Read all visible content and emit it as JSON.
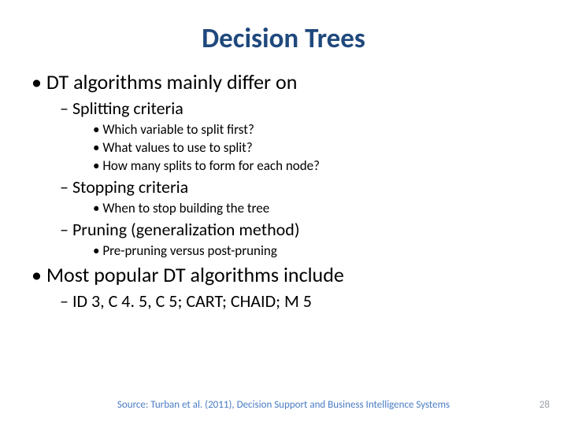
{
  "title": "Decision Trees",
  "bullets": [
    {
      "text": "DT algorithms mainly differ on",
      "children": [
        {
          "text": "Splitting criteria",
          "children": [
            {
              "text": "Which variable to split first?"
            },
            {
              "text": "What values to use to split?"
            },
            {
              "text": "How many splits to form for each node?"
            }
          ]
        },
        {
          "text": "Stopping criteria",
          "children": [
            {
              "text": "When to stop building the tree"
            }
          ]
        },
        {
          "text": "Pruning (generalization method)",
          "children": [
            {
              "text": "Pre-pruning versus post-pruning"
            }
          ]
        }
      ]
    },
    {
      "text": "Most popular DT algorithms include",
      "children": [
        {
          "text": "ID 3, C 4. 5, C 5; CART; CHAID; M 5"
        }
      ]
    }
  ],
  "source": "Source: Turban et al. (2011), Decision Support and Business Intelligence Systems",
  "pagenum": "28"
}
